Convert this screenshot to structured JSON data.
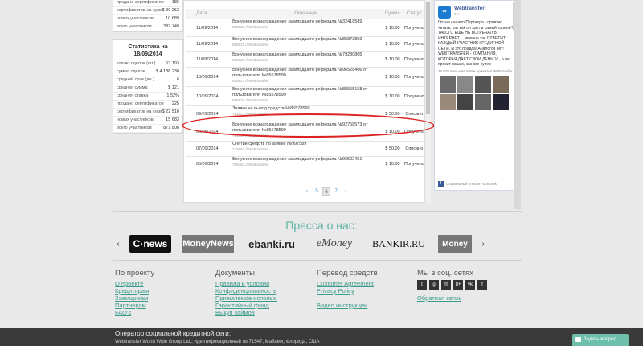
{
  "stats_top": [
    {
      "label": "продано сертификатов",
      "value": "186"
    },
    {
      "label": "сертификатов на сумму",
      "value": "$ 30 253"
    },
    {
      "label": "новых участников",
      "value": "10 689"
    },
    {
      "label": "всего участников",
      "value": "382 749"
    }
  ],
  "stats_box": {
    "title_line1": "Статистика на",
    "title_line2": "18/09/2014",
    "rows": [
      {
        "label": "кол-во сделок (шт.)",
        "value": "53 193"
      },
      {
        "label": "сумма сделок",
        "value": "$ 4 186 230"
      },
      {
        "label": "средний срок (дн.)",
        "value": "6"
      },
      {
        "label": "средняя сумма",
        "value": "$ 121"
      },
      {
        "label": "средняя ставка",
        "value": "1,52%"
      },
      {
        "label": "продано сертификатов",
        "value": "225"
      },
      {
        "label": "сертификатов на сумму",
        "value": "$ 22 510"
      },
      {
        "label": "новых участников",
        "value": "15 683"
      },
      {
        "label": "всего участников",
        "value": "871 808"
      }
    ]
  },
  "table": {
    "headers": {
      "date": "Дата",
      "desc": "Описание",
      "sum": "Сумма",
      "status": "Статус"
    },
    "rows": [
      {
        "date": "11/09/2014",
        "desc": "Бонусное вознаграждение за младшего реферала №32418589",
        "sub": "838622 // Webtransfer",
        "sum": "$ 10.00",
        "status": "Получено"
      },
      {
        "date": "11/09/2014",
        "desc": "Бонусное вознаграждение за младшего реферала №85873859",
        "sub": "838621 // Webtransfer",
        "sum": "$ 10.00",
        "status": "Получено"
      },
      {
        "date": "11/09/2014",
        "desc": "Бонусное вознаграждение за младшего реферала №79280805",
        "sub": "838620 // Webtransfer",
        "sum": "$ 10.00",
        "status": "Получено"
      },
      {
        "date": "10/09/2014",
        "desc": "Бонусное вознаграждение за младшего реферала №96528406 от пользователя №85578599",
        "sub": "835827 // Webtransfer",
        "sum": "$ 10.00",
        "status": "Получено"
      },
      {
        "date": "10/09/2014",
        "desc": "Бонусное вознаграждение за младшего реферала №85555158 от пользователя №85578599",
        "sub": "835826 // Webtransfer",
        "sum": "$ 10.00",
        "status": "Получено"
      },
      {
        "date": "09/09/2014",
        "desc": "Заявка на вывод средств №85578599",
        "sub": "782627 // Webtransfer",
        "sum": "$ 50.00",
        "status": "Списано"
      },
      {
        "date": "08/09/2014",
        "desc": "Бонусное вознаграждение за младшего реферала №92758573 от пользователя №85578599",
        "sub": "761536 // Webtransfer",
        "sum": "$ 10.00",
        "status": "Получено"
      },
      {
        "date": "07/09/2014",
        "desc": "Снятие средств по заявке №997589",
        "sub": "716661 // Webtransfer",
        "sum": "$ 50.00",
        "status": "Списано"
      },
      {
        "date": "05/09/2014",
        "desc": "Бонусное вознаграждение за младшего реферала №96592451",
        "sub": "796462 // Webtransfer",
        "sum": "$ 10.00",
        "status": "Получено"
      }
    ],
    "pager": {
      "prev": "‹",
      "p1": "5",
      "p2": "6",
      "p3": "7",
      "next": "›"
    }
  },
  "facebook": {
    "name": "Webtransfer",
    "sub": "3 ч.",
    "post": "Отзыв нашего Партнера - приятно читать, так как он зрит в самый корень!! ТАКОГО ЕЩЕ НЕ ВСТРЕЧАЛ В ИНТЕРНЕТ.....именно так ОТВЕТИТ КАЖДЫЙ УЧАСТНИК КРЕДИТНОЙ СЕТИ. И это правда! Аналогов нет! WEBTRANSFER - КОМПАНИЯ, КОТОРАЯ ДАЕТ СВОИ ДЕНЬГИ , а не просит ваших, как все супер-",
    "count": "25 818 пользователям нравится Webtransfer",
    "footer": "Социальный плагин Facebook"
  },
  "press": {
    "title": "Пресса о нас:",
    "logos": [
      "C·news",
      "MoneyNews",
      "ebanki.ru",
      "eMoney",
      "BANKIR.RU",
      "Money"
    ]
  },
  "footer": {
    "col1": {
      "title": "По проекту",
      "links": [
        "О проекте",
        "Кредиторам",
        "Заемщикам",
        "Партнерам",
        "FAQ's"
      ]
    },
    "col2": {
      "title": "Документы",
      "links": [
        "Правила и условия",
        "Конфиденциальность",
        "Приемлемое использ.",
        "Гарантийный фонд",
        "Выкуп займов"
      ]
    },
    "col3": {
      "title": "Перевод средств",
      "links": [
        "Customer Agreement",
        "Privacy Policy",
        "Видео инструкции"
      ]
    },
    "col4": {
      "title": "Мы в соц. сетях",
      "social": [
        "t",
        "g",
        "@",
        "8+",
        "vk",
        "f"
      ],
      "feedback": "Обратная связь"
    }
  },
  "bottom": {
    "line1": "Оператор социальной кредитной сети:",
    "line2": "Webtransfer World Wide Group Ltd., идентификационный № 71547, Майами, Флорида, США",
    "ask": "Задать вопрос"
  },
  "colors": {
    "accent": "#5fb3a3",
    "highlight": "#dd2222",
    "link": "#3b9b8c"
  }
}
